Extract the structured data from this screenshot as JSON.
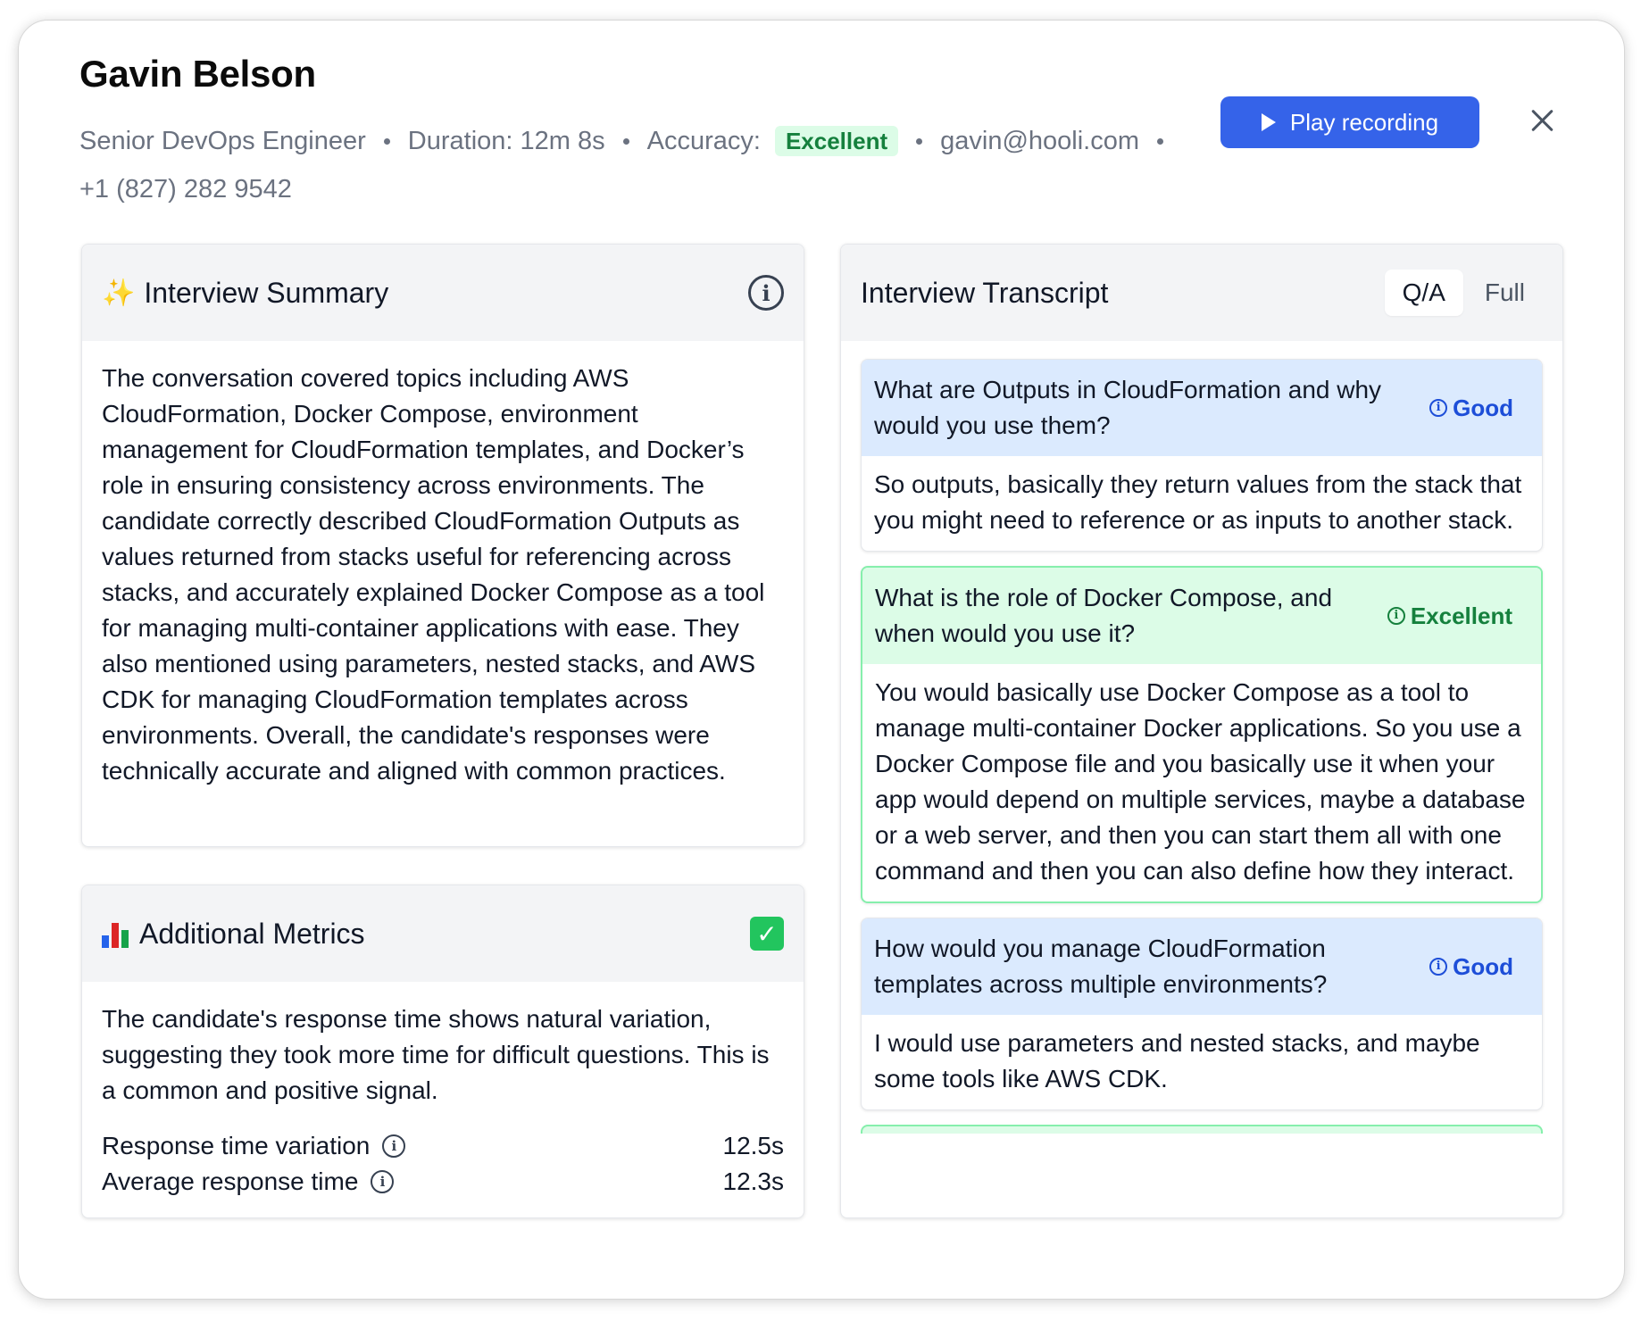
{
  "candidate": {
    "name": "Gavin Belson",
    "role": "Senior DevOps Engineer",
    "duration": "Duration: 12m 8s",
    "accuracy_label": "Accuracy:",
    "accuracy_badge": "Excellent",
    "email": "gavin@hooli.com",
    "phone": "+1 (827) 282 9542"
  },
  "actions": {
    "play_label": "Play recording",
    "close_icon": "close-icon"
  },
  "summary": {
    "emoji": "✨",
    "title": "Interview Summary",
    "text": "The conversation covered topics including AWS CloudFormation, Docker Compose, environment management for CloudFormation templates, and Docker’s role in ensuring consistency across environments. The candidate correctly described CloudFormation Outputs as values returned from stacks useful for referencing across stacks, and accurately explained Docker Compose as a tool for managing multi-container applications with ease. They also mentioned using parameters, nested stacks, and AWS CDK for managing CloudFormation templates across environments. Overall, the candidate's responses were technically accurate and aligned with common practices."
  },
  "metrics": {
    "title": "Additional Metrics",
    "description": "The candidate's response time shows natural variation, suggesting they took more time for difficult questions. This is a common and positive signal.",
    "rows": [
      {
        "label": "Response time variation",
        "value": "12.5s"
      },
      {
        "label": "Average response time",
        "value": "12.3s"
      }
    ]
  },
  "transcript": {
    "title": "Interview Transcript",
    "tabs": [
      "Q/A",
      "Full"
    ],
    "active_tab": "Q/A",
    "items": [
      {
        "question": "What are Outputs in CloudFormation and why would you use them?",
        "rating": "Good",
        "answer": "So outputs, basically they return values from the stack that you might need to reference or as inputs to another stack."
      },
      {
        "question": "What is the role of Docker Compose, and when would you use it?",
        "rating": "Excellent",
        "answer": "You would basically use Docker Compose as a tool to manage multi-container Docker applications. So you use a Docker Compose file and you basically use it when your app would depend on multiple services, maybe a database or a web server, and then you can start them all with one command and then you can also define how they interact."
      },
      {
        "question": "How would you manage CloudFormation templates across multiple environments?",
        "rating": "Good",
        "answer": "I would use parameters and nested stacks, and maybe some tools like AWS CDK."
      }
    ]
  },
  "colors": {
    "accent": "#3563e9",
    "good": "#1d4ed8",
    "excellent": "#15803d"
  }
}
